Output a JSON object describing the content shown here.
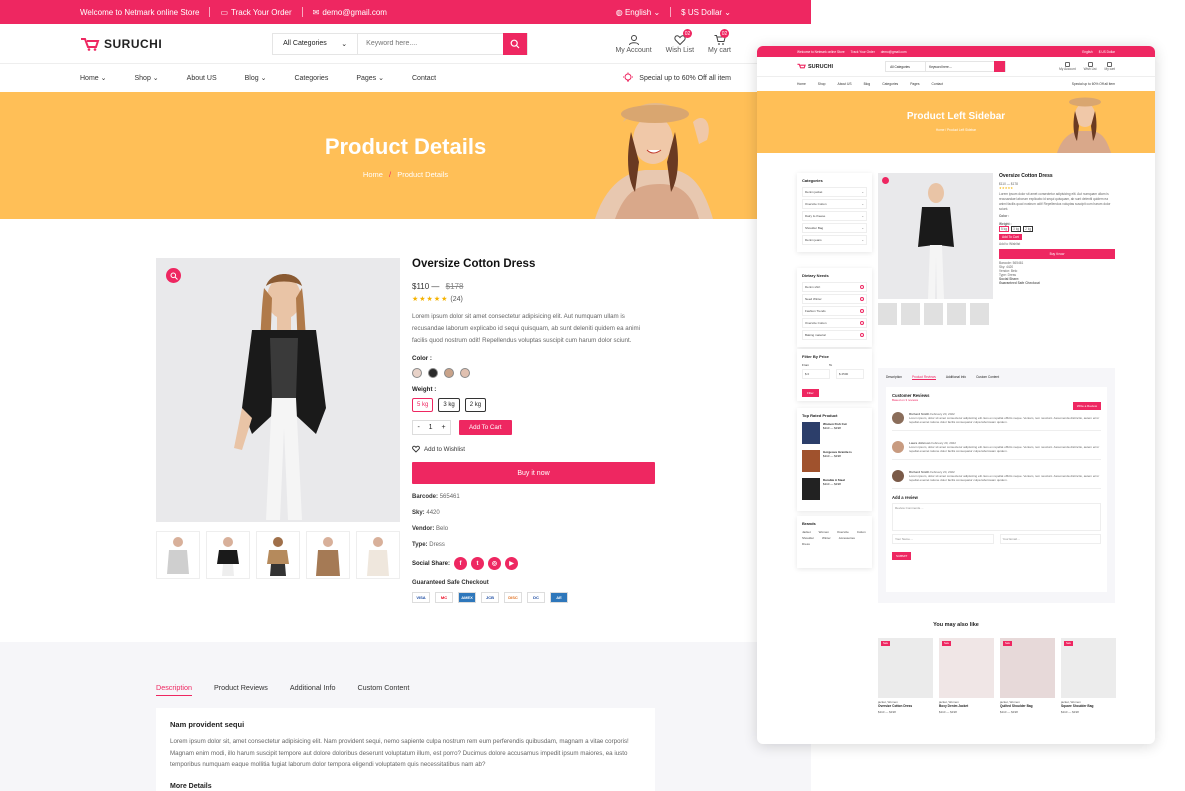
{
  "topbar": {
    "welcome": "Welcome to Netmark online Store",
    "track": "Track Your Order",
    "email": "demo@gmail.com",
    "language": "English",
    "currency": "$ US Dollar"
  },
  "header": {
    "logo": "SURUCHI",
    "category": "All Categories",
    "search_placeholder": "Keyword here....",
    "account": "My Account",
    "wishlist": "Wish List",
    "wishlist_count": "02",
    "cart": "My cart",
    "cart_count": "02"
  },
  "nav": {
    "items": [
      "Home",
      "Shop",
      "About US",
      "Blog",
      "Categories",
      "Pages",
      "Contact"
    ],
    "promo": "Special up to 60% Off all item"
  },
  "hero": {
    "title": "Product Details",
    "crumb_home": "Home",
    "crumb_current": "Product Details"
  },
  "product": {
    "title": "Oversize Cotton Dress",
    "price": "$110",
    "old_price": "$178",
    "stars": "★★★★★",
    "reviews": "(24)",
    "description": "Lorem ipsum dolor sit amet consectetur adipisicing elit. Aut numquam ullam is recusandae laborum explicabo id sequi quisquam, ab sunt deleniti quidem ea animi facilis quod nostrum odit! Repellendus voluptas suscipit cum harum dolor sciunt.",
    "color_label": "Color :",
    "weight_label": "Weight :",
    "weights": [
      "5 kg",
      "3 kg",
      "2 kg"
    ],
    "qty": "1",
    "add_to_cart": "Add To Cart",
    "wishlist": "Add to Wishlist",
    "buy_now": "Buy it now",
    "barcode_label": "Barcode:",
    "barcode": "565461",
    "sky_label": "Sky:",
    "sky": "4420",
    "vendor_label": "Vendor:",
    "vendor": "Belo",
    "type_label": "Type:",
    "type": "Dress",
    "social_label": "Social Share:",
    "checkout_label": "Guaranteed Safe Checkout",
    "payments": [
      "VISA",
      "MC",
      "AMEX",
      "JCB",
      "DISC",
      "DC",
      "AE"
    ]
  },
  "tabs": {
    "items": [
      "Description",
      "Product Reviews",
      "Additional Info",
      "Custom Content"
    ],
    "heading": "Nam provident sequi",
    "body": "Lorem ipsum dolor sit, amet consectetur adipisicing elit. Nam provident sequi, nemo sapiente culpa nostrum rem eum perferendis quibusdam, magnam a vitae corporis! Magnam enim modi, illo harum suscipit tempore aut dolore doloribus deserunt voluptatum illum, est porro? Ducimus dolore accusamus impedit ipsum maiores, ea iusto temporibus numquam eaque mollitia fugiat laborum dolor tempora eligendi voluptatem quis necessitatibus nam ab?",
    "more": "More Details"
  },
  "mini": {
    "welcome": "Welcome to Netmark online Store",
    "track": "Track Your Order",
    "email": "demo@gmail.com",
    "lang": "English",
    "currency": "$ US Dollar",
    "logo": "SURUCHI",
    "category": "All Categories",
    "search": "Keyword here....",
    "icons": [
      "My Account",
      "Wish List",
      "My cart"
    ],
    "nav": [
      "Home",
      "Shop",
      "About US",
      "Blog",
      "Categories",
      "Pages",
      "Contact"
    ],
    "promo": "Special up to 60% Off all item",
    "hero_title": "Product Left Sidebar",
    "crumb": "Home / Product Left Sidebar",
    "categories_title": "Categories",
    "categories": [
      "Denim jacket",
      "Oversize Cotton",
      "Dairy & cheese",
      "Shoulder Bag",
      "Denim jeans"
    ],
    "dietary_title": "Dietary Needs",
    "dietary": [
      "Denim shirt",
      "Need Winter",
      "Fashion Trends",
      "Oversize Cotton",
      "Baking material"
    ],
    "filter_title": "Filter By Price",
    "filter_from": "From",
    "filter_to": "To",
    "filter_min": "$ 0",
    "filter_max": "$ 2500",
    "filter_btn": "Filter",
    "top_title": "Top Rated Product",
    "top_items": [
      "Women Fish Cut",
      "Gorgeous Granite is",
      "Durable A Steel"
    ],
    "top_price": "$110 — $198",
    "brands_title": "Brands",
    "brands": [
      "Jacket",
      "Women",
      "Oversize",
      "Cotton",
      "Shoulder",
      "Winter",
      "Accessories",
      "Dress"
    ],
    "p_title": "Oversize Cotton Dress",
    "p_price": "$110 — $178",
    "p_desc": "Lorem ipsum dolor sit amet consectetur adipisicing elit. Aut numquam ullam is recusandae laborum explicabo id sequi quisquam, ab sunt deleniti quidem ea animi facilis quod nostrum odit! Repellendus voluptas suscipit cum harum dolor sciunt.",
    "p_color": "Color :",
    "p_weight": "Weight :",
    "p_weights": [
      "5 kg",
      "3 kg",
      "2 kg"
    ],
    "p_add": "Add To Cart",
    "p_wish": "Add to Wishlist",
    "p_buy": "Buy it now",
    "p_meta": [
      "Barcode: 565461",
      "Sky: 4420",
      "Vendor: Belo",
      "Type: Dress"
    ],
    "p_social": "Social Share:",
    "p_safe": "Guaranteed Safe Checkout",
    "tabs": [
      "Description",
      "Product Reviews",
      "Additional Info",
      "Custom Content"
    ],
    "reviews_title": "Customer Reviews",
    "reviews_sub": "Based on 3 reviews",
    "write": "Write a Review",
    "reviews": [
      {
        "name": "Richard Smith",
        "date": "February 20, 2022"
      },
      {
        "name": "Laura Johnson",
        "date": "February 20, 2022"
      },
      {
        "name": "Richard Smith",
        "date": "February 20, 2022"
      }
    ],
    "review_text": "Lorem ipsum, dolor sit amet consectetur adipisicing elit. Eos ex repellat officiis neque. Veniam, rem nesciunt. Assumenda distinctio, autem error repellat eveniet ratione dolor facilis consequatur culpa laboriosam quidem.",
    "add_review": "Add a review",
    "review_placeholder": "Review Comments....",
    "name_placeholder": "Your Name....",
    "email_placeholder": "Your Email....",
    "submit": "SUBMIT",
    "also": "You may also like",
    "cards": [
      {
        "cat": "jacket, Women",
        "name": "Oversize Cotton Dress",
        "price": "$110 — $198"
      },
      {
        "cat": "jacket, Women",
        "name": "Boxy Denim Jacket",
        "price": "$110 — $198"
      },
      {
        "cat": "jacket, Women",
        "name": "Quilted Shoulder Bag",
        "price": "$110 — $198"
      },
      {
        "cat": "jacket, Women",
        "name": "Square Shoulder Bag",
        "price": "$110 — $198"
      }
    ],
    "sale": "Sale"
  },
  "colors": {
    "accent": "#ee2761",
    "hero": "#ffbf57",
    "tab_bg": "#f6f6f9"
  }
}
